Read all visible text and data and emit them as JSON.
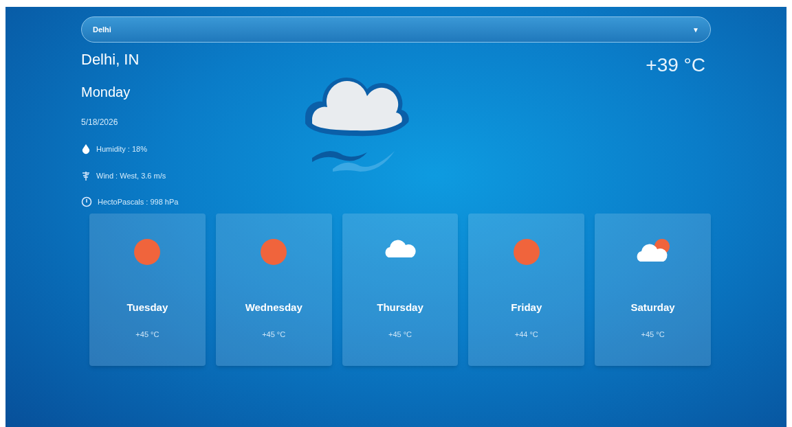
{
  "city_select": {
    "value": "Delhi",
    "arrow": "▼"
  },
  "location": "Delhi, IN",
  "temperature": "+39 °C",
  "day": "Monday",
  "date": "5/18/2026",
  "details": [
    {
      "kind": "humidity",
      "text": "Humidity : 18%"
    },
    {
      "kind": "wind",
      "text": "Wind : West, 3.6 m/s"
    },
    {
      "kind": "pressure",
      "text": "HectoPascals : 998 hPa"
    }
  ],
  "forecast": [
    {
      "kind": "sun",
      "day": "Tuesday",
      "temp": "+45 °C"
    },
    {
      "kind": "sun",
      "day": "Wednesday",
      "temp": "+45 °C"
    },
    {
      "kind": "cloud",
      "day": "Thursday",
      "temp": "+45 °C"
    },
    {
      "kind": "sun",
      "day": "Friday",
      "temp": "+44 °C"
    },
    {
      "kind": "cloud-sun",
      "day": "Saturday",
      "temp": "+45 °C"
    }
  ]
}
